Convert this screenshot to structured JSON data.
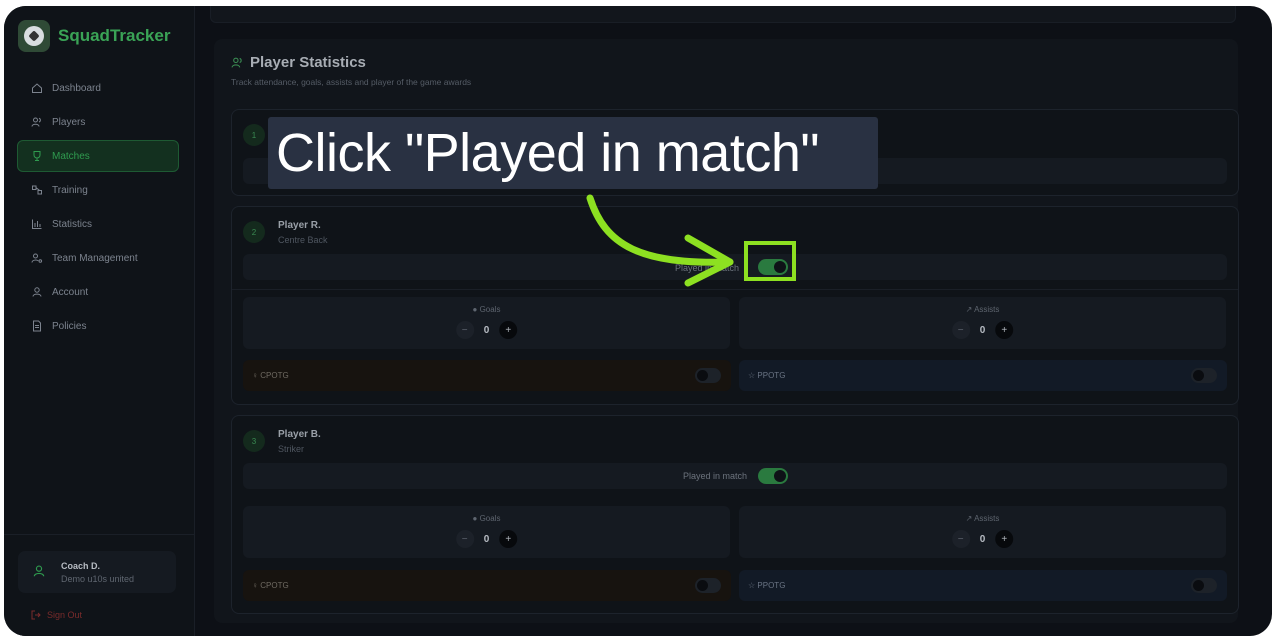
{
  "app": {
    "name": "SquadTracker"
  },
  "sidebar": {
    "items": [
      {
        "label": "Dashboard",
        "icon": "home-icon",
        "active": false
      },
      {
        "label": "Players",
        "icon": "users-icon",
        "active": false
      },
      {
        "label": "Matches",
        "icon": "trophy-icon",
        "active": true
      },
      {
        "label": "Training",
        "icon": "training-icon",
        "active": false
      },
      {
        "label": "Statistics",
        "icon": "bar-chart-icon",
        "active": false
      },
      {
        "label": "Team Management",
        "icon": "user-cog-icon",
        "active": false
      },
      {
        "label": "Account",
        "icon": "user-icon",
        "active": false
      },
      {
        "label": "Policies",
        "icon": "document-icon",
        "active": false
      }
    ],
    "user": {
      "name": "Coach D.",
      "team": "Demo u10s united"
    },
    "signout": "Sign Out"
  },
  "main": {
    "title": "Player Statistics",
    "subtitle": "Track attendance, goals, assists and player of the game awards",
    "players": [
      {
        "number": "1"
      },
      {
        "number": "2",
        "name": "Player R.",
        "role": "Centre Back",
        "played_label": "Played in match",
        "played": true,
        "goals_label": "Goals",
        "goals": "0",
        "assists_label": "Assists",
        "assists": "0",
        "cpotg_label": "CPOTG",
        "cpotg": false,
        "ppotg_label": "PPOTG",
        "ppotg": false
      },
      {
        "number": "3",
        "name": "Player B.",
        "role": "Striker",
        "played_label": "Played in match",
        "played": true,
        "goals_label": "Goals",
        "goals": "0",
        "assists_label": "Assists",
        "assists": "0",
        "cpotg_label": "CPOTG",
        "cpotg": false,
        "ppotg_label": "PPOTG",
        "ppotg": false
      }
    ]
  },
  "overlay": {
    "instruction": "Click \"Played in match\"",
    "highlight_color": "#8de021"
  },
  "colors": {
    "accent": "#2f9b4f",
    "background": "#0d1016"
  }
}
